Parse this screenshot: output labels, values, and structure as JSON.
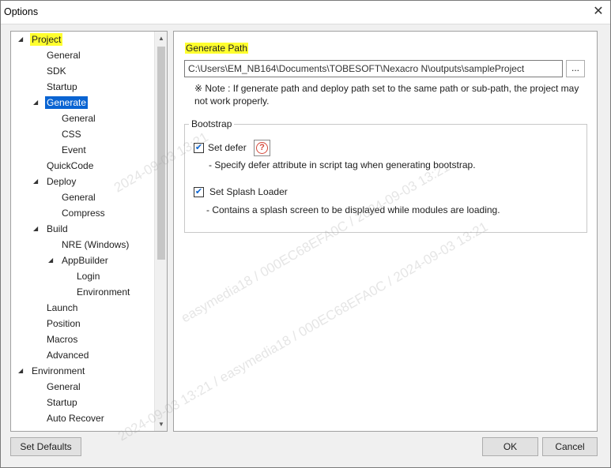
{
  "window": {
    "title": "Options"
  },
  "tree": {
    "items": [
      {
        "label": "Project",
        "level": 0,
        "expanded": true,
        "highlighted": true
      },
      {
        "label": "General",
        "level": 1
      },
      {
        "label": "SDK",
        "level": 1
      },
      {
        "label": "Startup",
        "level": 1
      },
      {
        "label": "Generate",
        "level": 1,
        "expanded": true,
        "selected": true
      },
      {
        "label": "General",
        "level": 2
      },
      {
        "label": "CSS",
        "level": 2
      },
      {
        "label": "Event",
        "level": 2
      },
      {
        "label": "QuickCode",
        "level": 1
      },
      {
        "label": "Deploy",
        "level": 1,
        "expanded": true
      },
      {
        "label": "General",
        "level": 2
      },
      {
        "label": "Compress",
        "level": 2
      },
      {
        "label": "Build",
        "level": 1,
        "expanded": true
      },
      {
        "label": "NRE (Windows)",
        "level": 2
      },
      {
        "label": "AppBuilder",
        "level": 2,
        "expanded": true
      },
      {
        "label": "Login",
        "level": 3
      },
      {
        "label": "Environment",
        "level": 3
      },
      {
        "label": "Launch",
        "level": 1
      },
      {
        "label": "Position",
        "level": 1
      },
      {
        "label": "Macros",
        "level": 1
      },
      {
        "label": "Advanced",
        "level": 1
      },
      {
        "label": "Environment",
        "level": 0,
        "expanded": true
      },
      {
        "label": "General",
        "level": 1
      },
      {
        "label": "Startup",
        "level": 1
      },
      {
        "label": "Auto Recover",
        "level": 1
      }
    ]
  },
  "generate": {
    "section_title": "Generate Path",
    "path_value": "C:\\Users\\EM_NB164\\Documents\\TOBESOFT\\Nexacro N\\outputs\\sampleProject",
    "browse_label": "...",
    "note": "※ Note : If generate path and deploy path set to the same path or sub-path, the project may not work properly."
  },
  "bootstrap": {
    "legend": "Bootstrap",
    "set_defer": {
      "label": "Set defer",
      "checked": true,
      "description": "- Specify defer attribute in script tag when generating bootstrap."
    },
    "splash": {
      "label": "Set Splash Loader",
      "checked": true,
      "description": "- Contains a splash screen to be displayed while modules are loading."
    }
  },
  "buttons": {
    "set_defaults": "Set Defaults",
    "ok": "OK",
    "cancel": "Cancel"
  },
  "watermark": {
    "lines": [
      "2024-09-03 13:21",
      "easymedia18 / 000EC68EFA0C / 2024-09-03 13:21",
      "2024-09-03 13:21 / easymedia18 / 000EC68EFA0C / 2024-09-03 13:21"
    ]
  }
}
